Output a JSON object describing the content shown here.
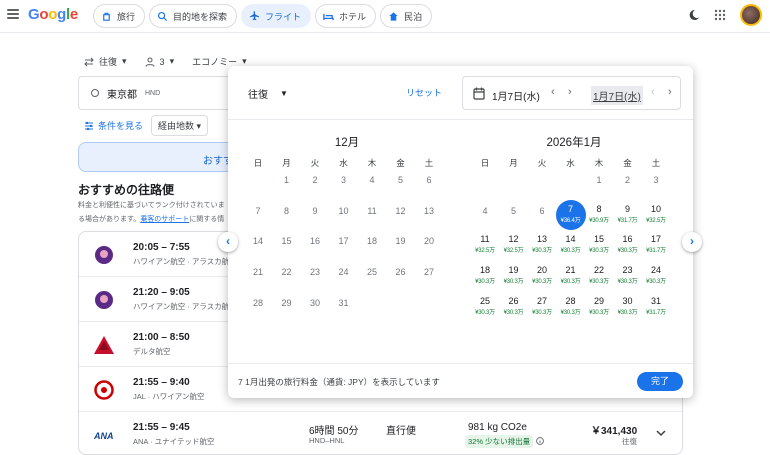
{
  "header": {
    "logo": "Google",
    "chips": [
      {
        "label": "旅行",
        "icon": "travel-icon"
      },
      {
        "label": "目的地を探索",
        "icon": "explore-icon"
      },
      {
        "label": "フライト",
        "icon": "flight-icon"
      },
      {
        "label": "ホテル",
        "icon": "hotel-icon"
      },
      {
        "label": "民泊",
        "icon": "home-icon"
      }
    ]
  },
  "search": {
    "trip_type": "往復",
    "passengers": "3",
    "cabin": "エコノミー",
    "origin": "東京都",
    "origin_code": "HND",
    "filters_link": "条件を見る",
    "stops_filter": "経由地数",
    "search_button": "おすす"
  },
  "section": {
    "title": "おすすめの往路便",
    "note1": "料金と利便性に基づいてランク付けされていま",
    "note2": "る場合があります。",
    "note_link": "乗客のサポート",
    "note3": "に関する情"
  },
  "flights": [
    {
      "times": "20:05 – 7:55",
      "carrier": "ハワイアン航空 · アラスカ航空",
      "logo": "hawaiian"
    },
    {
      "times": "21:20 – 9:05",
      "carrier": "ハワイアン航空 · アラスカ航空",
      "logo": "hawaiian"
    },
    {
      "times": "21:00 – 8:50",
      "carrier": "デルタ航空",
      "logo": "delta"
    },
    {
      "times": "21:55 – 9:40",
      "carrier": "JAL · ハワイアン航空",
      "logo": "jal"
    },
    {
      "times": "21:55 – 9:45",
      "carrier": "ANA · ユナイテッド航空",
      "logo": "ana",
      "duration": "6時間 50分",
      "route": "HND–HNL",
      "stops": "直行便",
      "co2": "981 kg CO2e",
      "co2_badge": "32% 少ない排出量",
      "price": "￥341,430",
      "price_type": "往復"
    }
  ],
  "picker": {
    "trip_type": "往復",
    "reset": "リセット",
    "depart_date": "1月7日(水)",
    "return_date": "1月7日(水)",
    "note": "7 1月出発の旅行料金（通貨: JPY）を表示しています",
    "done": "完了",
    "weekdays": [
      "日",
      "月",
      "火",
      "水",
      "木",
      "金",
      "土"
    ],
    "months": [
      {
        "title": "12月",
        "days": [
          {
            "d": "1",
            "col": 1,
            "row": 0
          },
          {
            "d": "2",
            "col": 2,
            "row": 0
          },
          {
            "d": "3",
            "col": 3,
            "row": 0
          },
          {
            "d": "4",
            "col": 4,
            "row": 0
          },
          {
            "d": "5",
            "col": 5,
            "row": 0
          },
          {
            "d": "6",
            "col": 6,
            "row": 0
          },
          {
            "d": "7",
            "col": 0,
            "row": 1
          },
          {
            "d": "8",
            "col": 1,
            "row": 1
          },
          {
            "d": "9",
            "col": 2,
            "row": 1
          },
          {
            "d": "10",
            "col": 3,
            "row": 1
          },
          {
            "d": "11",
            "col": 4,
            "row": 1
          },
          {
            "d": "12",
            "col": 5,
            "row": 1
          },
          {
            "d": "13",
            "col": 6,
            "row": 1
          },
          {
            "d": "14",
            "col": 0,
            "row": 2
          },
          {
            "d": "15",
            "col": 1,
            "row": 2
          },
          {
            "d": "16",
            "col": 2,
            "row": 2
          },
          {
            "d": "17",
            "col": 3,
            "row": 2
          },
          {
            "d": "18",
            "col": 4,
            "row": 2
          },
          {
            "d": "19",
            "col": 5,
            "row": 2
          },
          {
            "d": "20",
            "col": 6,
            "row": 2
          },
          {
            "d": "21",
            "col": 0,
            "row": 3
          },
          {
            "d": "22",
            "col": 1,
            "row": 3
          },
          {
            "d": "23",
            "col": 2,
            "row": 3
          },
          {
            "d": "24",
            "col": 3,
            "row": 3
          },
          {
            "d": "25",
            "col": 4,
            "row": 3
          },
          {
            "d": "26",
            "col": 5,
            "row": 3
          },
          {
            "d": "27",
            "col": 6,
            "row": 3
          },
          {
            "d": "28",
            "col": 0,
            "row": 4
          },
          {
            "d": "29",
            "col": 1,
            "row": 4
          },
          {
            "d": "30",
            "col": 2,
            "row": 4
          },
          {
            "d": "31",
            "col": 3,
            "row": 4
          }
        ]
      },
      {
        "title": "2026年1月",
        "days": [
          {
            "d": "1",
            "col": 4,
            "row": 0
          },
          {
            "d": "2",
            "col": 5,
            "row": 0
          },
          {
            "d": "3",
            "col": 6,
            "row": 0
          },
          {
            "d": "4",
            "col": 0,
            "row": 1
          },
          {
            "d": "5",
            "col": 1,
            "row": 1
          },
          {
            "d": "6",
            "col": 2,
            "row": 1
          },
          {
            "d": "7",
            "col": 3,
            "row": 1,
            "p": "¥36.4万",
            "sel": true
          },
          {
            "d": "8",
            "col": 4,
            "row": 1,
            "p": "¥30.9万"
          },
          {
            "d": "9",
            "col": 5,
            "row": 1,
            "p": "¥31.7万"
          },
          {
            "d": "10",
            "col": 6,
            "row": 1,
            "p": "¥32.5万"
          },
          {
            "d": "11",
            "col": 0,
            "row": 2,
            "p": "¥32.5万"
          },
          {
            "d": "12",
            "col": 1,
            "row": 2,
            "p": "¥32.5万"
          },
          {
            "d": "13",
            "col": 2,
            "row": 2,
            "p": "¥30.3万"
          },
          {
            "d": "14",
            "col": 3,
            "row": 2,
            "p": "¥30.3万"
          },
          {
            "d": "15",
            "col": 4,
            "row": 2,
            "p": "¥30.3万"
          },
          {
            "d": "16",
            "col": 5,
            "row": 2,
            "p": "¥30.3万"
          },
          {
            "d": "17",
            "col": 6,
            "row": 2,
            "p": "¥31.7万"
          },
          {
            "d": "18",
            "col": 0,
            "row": 3,
            "p": "¥30.3万"
          },
          {
            "d": "19",
            "col": 1,
            "row": 3,
            "p": "¥30.3万"
          },
          {
            "d": "20",
            "col": 2,
            "row": 3,
            "p": "¥30.3万"
          },
          {
            "d": "21",
            "col": 3,
            "row": 3,
            "p": "¥30.3万"
          },
          {
            "d": "22",
            "col": 4,
            "row": 3,
            "p": "¥30.3万"
          },
          {
            "d": "23",
            "col": 5,
            "row": 3,
            "p": "¥30.3万"
          },
          {
            "d": "24",
            "col": 6,
            "row": 3,
            "p": "¥30.3万"
          },
          {
            "d": "25",
            "col": 0,
            "row": 4,
            "p": "¥30.3万"
          },
          {
            "d": "26",
            "col": 1,
            "row": 4,
            "p": "¥30.3万"
          },
          {
            "d": "27",
            "col": 2,
            "row": 4,
            "p": "¥30.3万"
          },
          {
            "d": "28",
            "col": 3,
            "row": 4,
            "p": "¥30.3万"
          },
          {
            "d": "29",
            "col": 4,
            "row": 4,
            "p": "¥30.3万"
          },
          {
            "d": "30",
            "col": 5,
            "row": 4,
            "p": "¥30.3万"
          },
          {
            "d": "31",
            "col": 6,
            "row": 4,
            "p": "¥31.7万"
          }
        ]
      }
    ]
  }
}
